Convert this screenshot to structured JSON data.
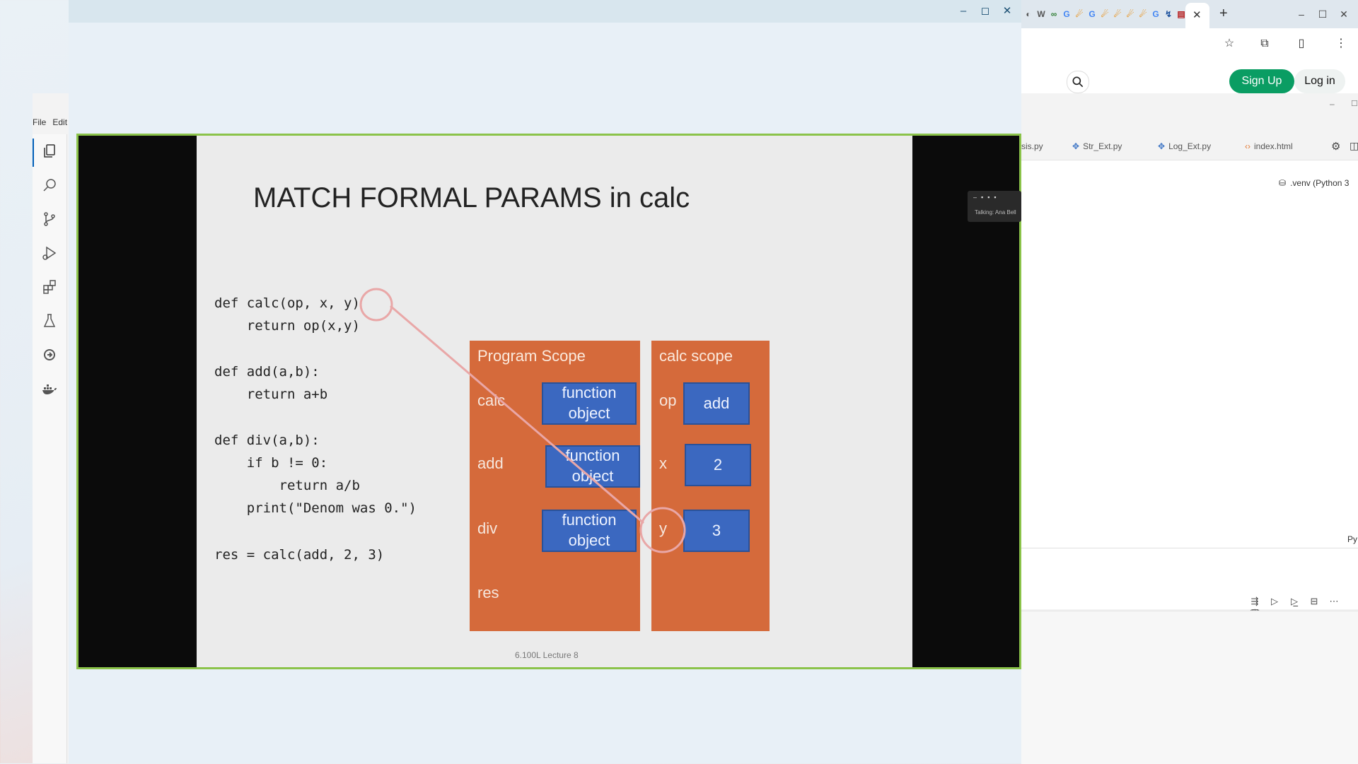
{
  "vscode": {
    "menu": [
      "File",
      "Edit"
    ],
    "activity_icons": [
      "files-icon",
      "search-icon",
      "source-control-icon",
      "run-debug-icon",
      "extensions-icon",
      "testing-icon",
      "remote-icon",
      "docker-icon"
    ],
    "tabs": [
      {
        "label": "sis.py",
        "icon": "python-icon"
      },
      {
        "label": "Str_Ext.py",
        "icon": "python-icon"
      },
      {
        "label": "Log_Ext.py",
        "icon": "python-icon"
      },
      {
        "label": "index.html",
        "icon": "html-icon"
      }
    ],
    "kernel_label": ".venv (Python 3",
    "py_label": "Py",
    "cell_toolbar": [
      "execute-above-icon",
      "execute-cell-icon",
      "execute-below-icon",
      "split-cell-icon",
      "more-icon",
      "delete-icon"
    ]
  },
  "browser": {
    "tab_favicons": [
      "W",
      "G",
      "G",
      "G"
    ],
    "sign_up": "Sign Up",
    "log_in": "Log in",
    "new_tab": "+",
    "colors": {
      "signup_bg": "#0a9d63"
    }
  },
  "player": {
    "controls": [
      "minimize",
      "maximize",
      "close"
    ]
  },
  "slide": {
    "title": "MATCH FORMAL PARAMS in calc",
    "code_lines": [
      "def calc(op, x, y)",
      "    return op(x,y)",
      "",
      "def add(a,b):",
      "    return a+b",
      "",
      "def div(a,b):",
      "    if b != 0:",
      "        return a/b",
      "    print(\"Denom was 0.\")",
      "",
      "res = calc(add, 2, 3)"
    ],
    "program_scope": {
      "heading": "Program Scope",
      "labels": [
        "calc",
        "add",
        "div",
        "res"
      ],
      "values": [
        "function object",
        "function object",
        "function object"
      ]
    },
    "calc_scope": {
      "heading": "calc scope",
      "labels": [
        "op",
        "x",
        "y"
      ],
      "values": [
        "add",
        "2",
        "3"
      ]
    },
    "footer": "6.100L Lecture 8",
    "colors": {
      "scope_box": "#d56a3b",
      "value_box": "#3b68c0",
      "circle": "#e9a7a7"
    }
  },
  "mini_window": {
    "caption": "Talking: Ana Bell"
  }
}
